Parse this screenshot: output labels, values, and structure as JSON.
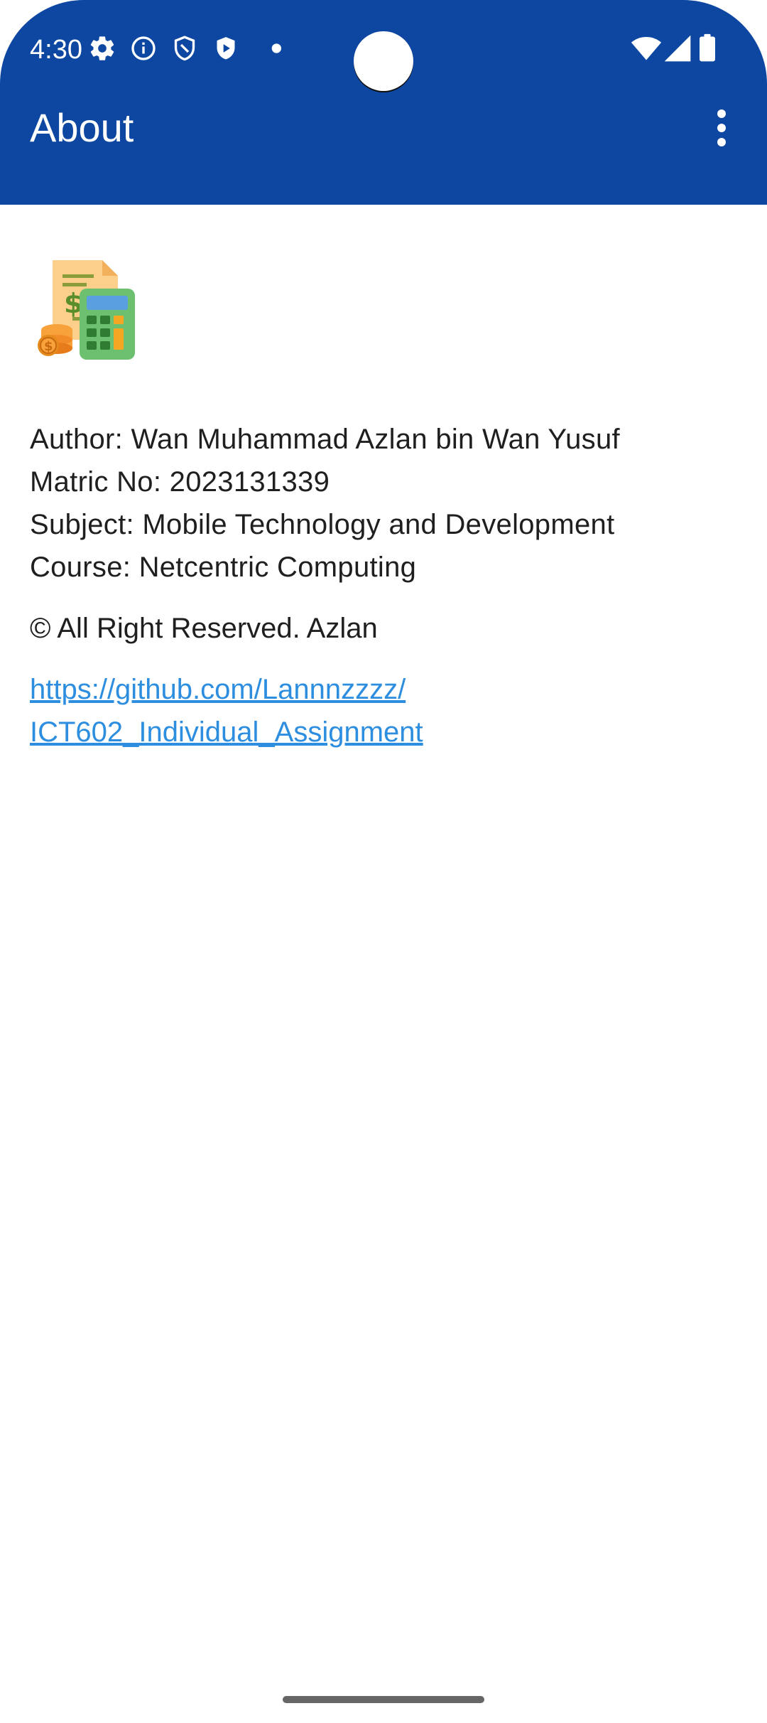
{
  "status_bar": {
    "time": "4:30",
    "icons": [
      "settings-icon",
      "info-icon",
      "shield-icon",
      "play-shield-icon",
      "dot-icon",
      "wifi-icon",
      "signal-icon",
      "battery-icon"
    ]
  },
  "app_bar": {
    "title": "About",
    "menu_icon": "more-vert-icon",
    "color": "#0d47a1"
  },
  "content": {
    "logo_icon": "calculator-money-icon",
    "author": "Author: Wan Muhammad Azlan bin Wan Yusuf",
    "matric": "Matric No: 2023131339",
    "subject": "Subject: Mobile Technology and Development",
    "course": "Course: Netcentric Computing",
    "copyright": "© All Right Reserved. Azlan",
    "link_line1": "https://github.com/Lannnzzzz/",
    "link_line2": "ICT602_Individual_Assignment",
    "link_color": "#2d8ee0"
  }
}
